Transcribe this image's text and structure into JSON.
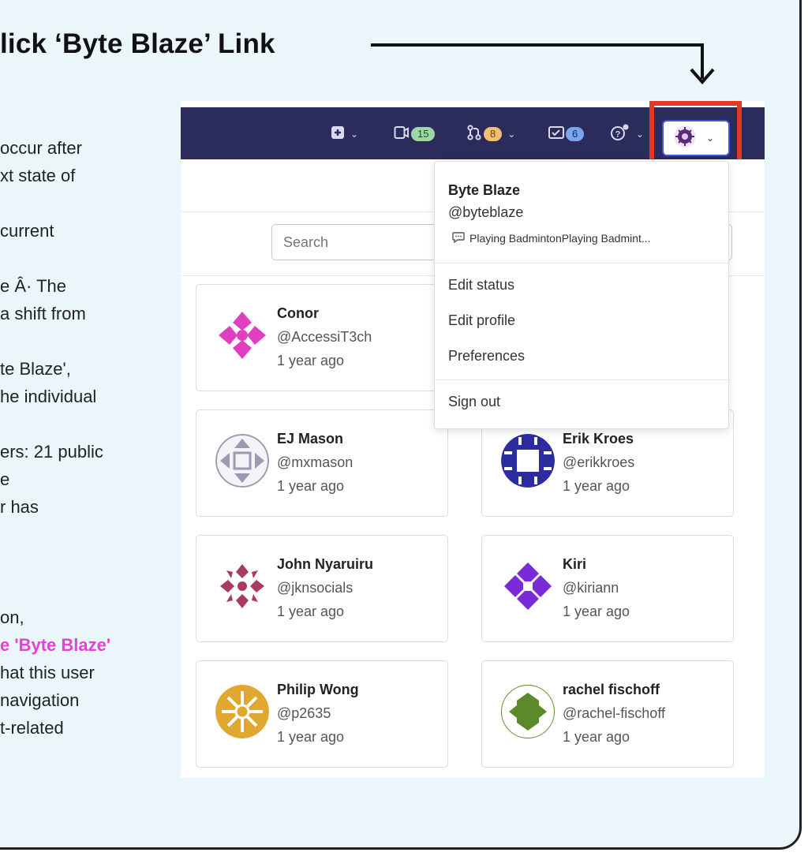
{
  "annotation": {
    "headline": "lick ‘Byte Blaze’ Link",
    "side_lines": [
      "occur after",
      "xt state of",
      "",
      "current",
      "",
      "e Â· The",
      " a shift from",
      "",
      "te Blaze',",
      "he individual",
      "",
      "ers: 21 public",
      "e",
      "r has",
      "",
      "",
      "",
      "on,",
      "e 'Byte Blaze'",
      "hat this user",
      "navigation",
      "t-related"
    ],
    "highlight_color": "#e83fd7",
    "arrow_color": "#111111",
    "box_color": "#e8371f"
  },
  "topbar": {
    "bg_color": "#2b2b5c",
    "issues_count": "15",
    "mr_count": "8",
    "todos_count": "6"
  },
  "search": {
    "placeholder": "Search"
  },
  "dropdown": {
    "name": "Byte Blaze",
    "handle": "@byteblaze",
    "status": "Playing BadmintonPlaying Badmint...",
    "items": [
      "Edit status",
      "Edit profile",
      "Preferences"
    ],
    "sign_out": "Sign out"
  },
  "users": [
    {
      "name": "Conor",
      "handle": "@AccessiT3ch",
      "time": "1 year ago",
      "color": "#e040c0"
    },
    {
      "name": "EJ Mason",
      "handle": "@mxmason",
      "time": "1 year ago",
      "color": "#9a9ab0"
    },
    {
      "name": "Erik Kroes",
      "handle": "@erikkroes",
      "time": "1 year ago",
      "color": "#2c2c9e"
    },
    {
      "name": "John Nyaruiru",
      "handle": "@jknsocials",
      "time": "1 year ago",
      "color": "#a83c5c"
    },
    {
      "name": "Kiri",
      "handle": "@kiriann",
      "time": "1 year ago",
      "color": "#7a2ad8"
    },
    {
      "name": "Philip Wong",
      "handle": "@p2635",
      "time": "1 year ago",
      "color": "#e0a830"
    },
    {
      "name": "rachel fischoff",
      "handle": "@rachel-fischoff",
      "time": "1 year ago",
      "color": "#5a8a2a"
    }
  ]
}
